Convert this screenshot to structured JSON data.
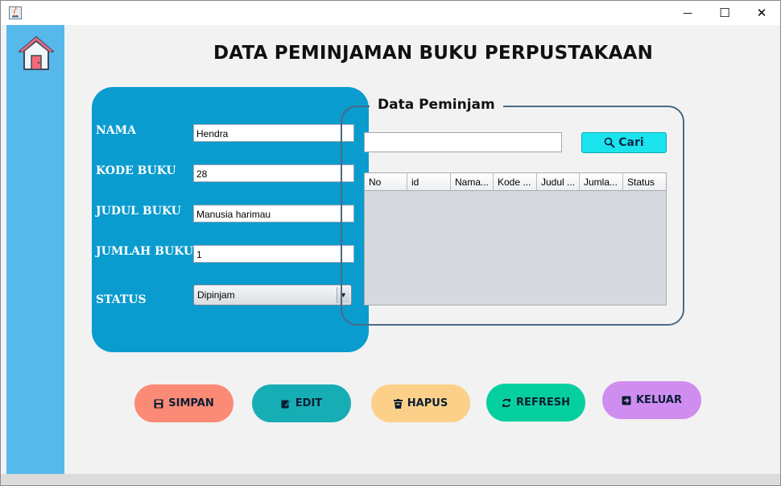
{
  "window": {
    "minimize": "—",
    "maximize": "☐",
    "close": "✕"
  },
  "page": {
    "title": "DATA PEMINJAMAN BUKU PERPUSTAKAAN"
  },
  "form": {
    "fields": [
      {
        "label": "NAMA",
        "value": "Hendra"
      },
      {
        "label": "KODE BUKU",
        "value": "28"
      },
      {
        "label": "JUDUL BUKU",
        "value": "Manusia harimau"
      },
      {
        "label": "JUMLAH BUKU",
        "value": "1"
      }
    ],
    "status": {
      "label": "STATUS",
      "value": "Dipinjam",
      "arrow": "▼"
    }
  },
  "borrowers": {
    "title": "Data Peminjam",
    "search": {
      "value": "",
      "button": "Cari"
    },
    "columns": [
      "No",
      "id",
      "Nama...",
      "Kode ...",
      "Judul ...",
      "Jumla...",
      "Status"
    ],
    "rows": []
  },
  "actions": {
    "simpan": "SIMPAN",
    "edit": "EDIT",
    "hapus": "HAPUS",
    "refresh": "REFRESH",
    "keluar": "KELUAR"
  },
  "colors": {
    "sidebar": "#57b8ec",
    "form_panel": "#0a9ccf",
    "simpan": "#fb8a76",
    "edit": "#17adb5",
    "hapus": "#fdd089",
    "refresh": "#06cf9f",
    "keluar": "#cf8df0",
    "cari": "#1ce4ee"
  }
}
